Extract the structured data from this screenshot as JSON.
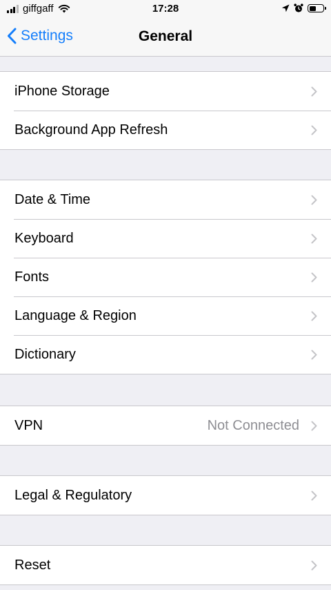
{
  "status_bar": {
    "carrier": "giffgaff",
    "time": "17:28",
    "icons": [
      "signal-icon",
      "wifi-icon",
      "location-icon",
      "alarm-icon",
      "battery-icon"
    ]
  },
  "nav": {
    "back_label": "Settings",
    "title": "General",
    "accent_color": "#147efb"
  },
  "groups": [
    {
      "items": [
        {
          "label": "iPhone Storage"
        },
        {
          "label": "Background App Refresh"
        }
      ]
    },
    {
      "items": [
        {
          "label": "Date & Time"
        },
        {
          "label": "Keyboard"
        },
        {
          "label": "Fonts"
        },
        {
          "label": "Language & Region"
        },
        {
          "label": "Dictionary"
        }
      ]
    },
    {
      "items": [
        {
          "label": "VPN",
          "value": "Not Connected"
        }
      ]
    },
    {
      "items": [
        {
          "label": "Legal & Regulatory"
        }
      ]
    },
    {
      "items": [
        {
          "label": "Reset"
        }
      ]
    }
  ]
}
